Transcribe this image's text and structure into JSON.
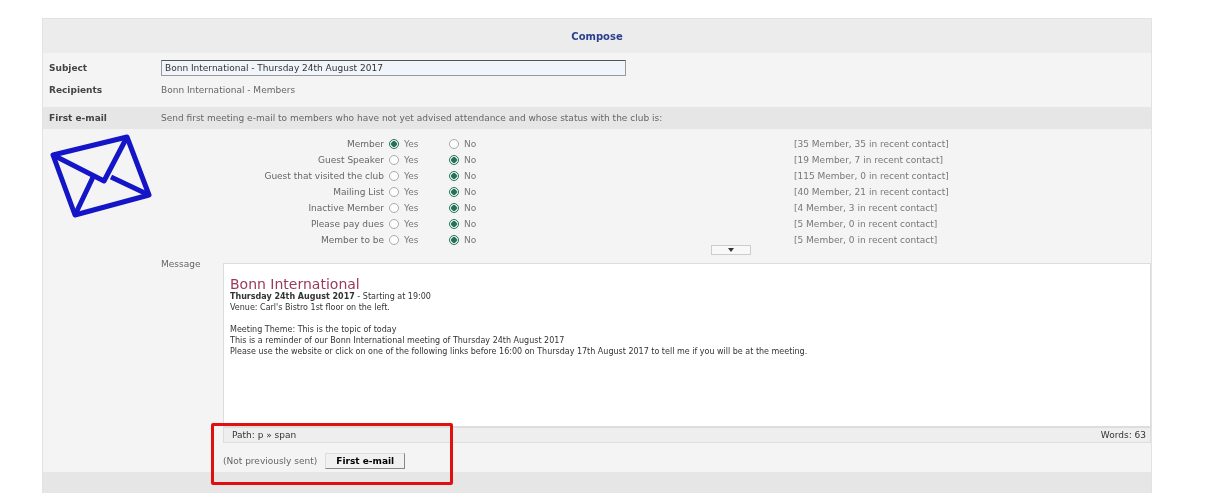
{
  "header": {
    "title": "Compose"
  },
  "subject": {
    "label": "Subject",
    "value": "Bonn International - Thursday 24th August 2017"
  },
  "recipients": {
    "label": "Recipients",
    "value": "Bonn International - Members"
  },
  "first_email": {
    "label": "First e-mail",
    "description": "Send first meeting e-mail to members who have not yet advised attendance and whose status with the club is:"
  },
  "statuses": [
    {
      "label": "Member",
      "yes": {
        "label": "Yes",
        "selected": true
      },
      "no": {
        "label": "No",
        "selected": false
      },
      "count": "[35 Member, 35 in recent contact]"
    },
    {
      "label": "Guest Speaker",
      "yes": {
        "label": "Yes",
        "selected": false
      },
      "no": {
        "label": "No",
        "selected": true
      },
      "count": "[19 Member, 7 in recent contact]"
    },
    {
      "label": "Guest that visited the club",
      "yes": {
        "label": "Yes",
        "selected": false
      },
      "no": {
        "label": "No",
        "selected": true
      },
      "count": "[115 Member, 0 in recent contact]"
    },
    {
      "label": "Mailing List",
      "yes": {
        "label": "Yes",
        "selected": false
      },
      "no": {
        "label": "No",
        "selected": true
      },
      "count": "[40 Member, 21 in recent contact]"
    },
    {
      "label": "Inactive Member",
      "yes": {
        "label": "Yes",
        "selected": false
      },
      "no": {
        "label": "No",
        "selected": true
      },
      "count": "[4 Member, 3 in recent contact]"
    },
    {
      "label": "Please pay dues",
      "yes": {
        "label": "Yes",
        "selected": false
      },
      "no": {
        "label": "No",
        "selected": true
      },
      "count": "[5 Member, 0 in recent contact]"
    },
    {
      "label": "Member to be",
      "yes": {
        "label": "Yes",
        "selected": false
      },
      "no": {
        "label": "No",
        "selected": true
      },
      "count": "[5 Member, 0 in recent contact]"
    }
  ],
  "message": {
    "label": "Message",
    "heading": "Bonn International",
    "paragraphs": [
      [
        "**Thursday 24th August 2017** - Starting at 19:00",
        "Venue: Carl's Bistro 1st floor on the left."
      ],
      [
        "Meeting Theme: This is the topic of today",
        "This is a reminder of our Bonn International meeting of Thursday 24th August 2017",
        "Please use the website or click on one of the following links before 16:00 on Thursday 17th August 2017 to tell me if you will be at the meeting."
      ]
    ],
    "path": "Path: p » span",
    "words": "Words: 63"
  },
  "send": {
    "note": "(Not previously sent)",
    "button": "First e-mail"
  }
}
